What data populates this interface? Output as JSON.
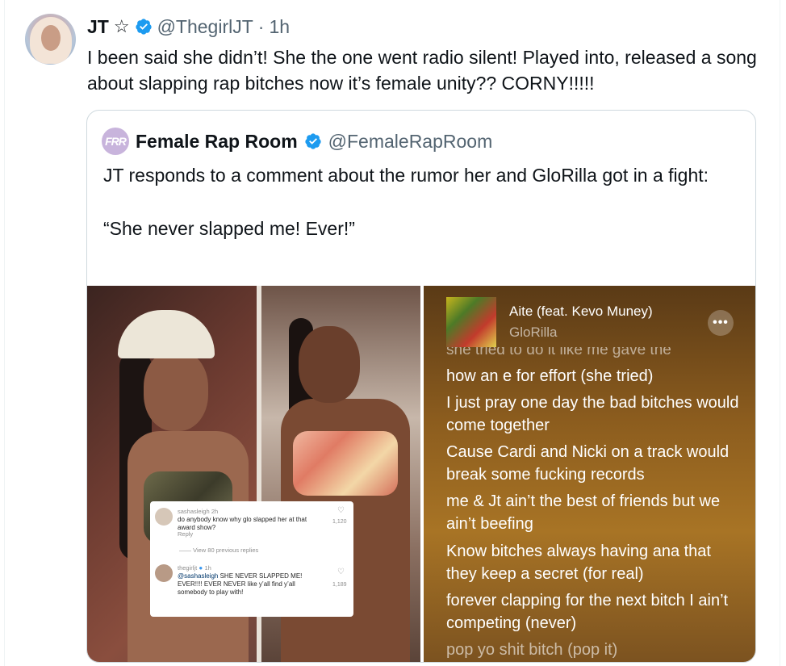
{
  "tweet": {
    "author_name": "JT",
    "handle": "@ThegirlJT",
    "dot": "·",
    "time": "1h",
    "star_icon": "star-icon",
    "text": "I been said she didn’t! She the one went radio silent! Played into, released a song about slapping rap bitches now it’s female unity?? CORNY!!!!!"
  },
  "quote": {
    "avatar_text": "FRR",
    "name": "Female Rap Room",
    "handle": "@FemaleRapRoom",
    "text": "JT responds to a comment about the rumor her and GloRilla got in a fight:\n\n“She never slapped me! Ever!”"
  },
  "instagram": {
    "comment1_user": "sashasleigh",
    "comment1_time": "2h",
    "comment1_text": "do anybody know why glo slapped her at that award show?",
    "comment1_likes": "1,120",
    "reply_label": "Reply",
    "view_replies": "View 80 previous replies",
    "comment2_user": "thegirljt",
    "comment2_time": "1h",
    "comment2_mention": "@sashasleigh",
    "comment2_text": " SHE NEVER SLAPPED ME! EVER!!!! EVER NEVER like y’all find y’all somebody to play with!",
    "comment2_likes": "1,189"
  },
  "lyrics": {
    "song_title": "Aite (feat. Kevo Muney)",
    "artist": "GloRilla",
    "more_label": "•••",
    "fade_line": "she tried to do it like me gave the",
    "lines": [
      "how an e for effort (she tried)",
      "I just pray one day the bad bitches would come together",
      "Cause Cardi and Nicki on a track would break some fucking records",
      "me & Jt ain’t the best of friends but we ain’t beefing",
      "Know bitches always having ana that they keep a secret (for real)",
      "forever clapping for the next bitch I ain’t competing (never)",
      "pop yo shit bitch (pop it)"
    ]
  },
  "colors": {
    "verified": "#1d9bf0",
    "handle_gray": "#536471",
    "border": "#cfd9de"
  }
}
